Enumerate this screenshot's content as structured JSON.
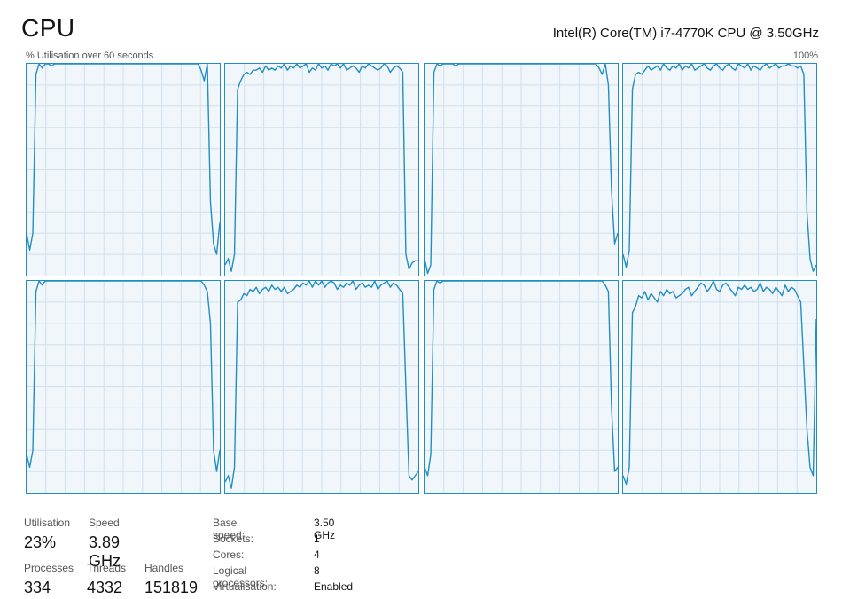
{
  "header": {
    "title": "CPU",
    "cpu_model": "Intel(R) Core(TM) i7-4770K CPU @ 3.50GHz",
    "axis_label": "% Utilisation over 60 seconds",
    "axis_max": "100%"
  },
  "colors": {
    "line": "#1f8ec4",
    "grid": "#cfe0ec",
    "panel_bg": "#f1f6fa",
    "border": "#1f8ec4"
  },
  "chart_data": [
    {
      "type": "line",
      "name": "logical-processor-0",
      "ylim": [
        0,
        100
      ],
      "values": [
        20,
        12,
        20,
        95,
        100,
        98,
        100,
        100,
        99,
        100,
        100,
        100,
        100,
        100,
        100,
        100,
        100,
        100,
        100,
        100,
        100,
        100,
        100,
        100,
        100,
        100,
        100,
        100,
        100,
        100,
        100,
        100,
        100,
        100,
        100,
        100,
        100,
        100,
        100,
        100,
        100,
        100,
        100,
        100,
        100,
        100,
        100,
        100,
        100,
        100,
        100,
        100,
        100,
        100,
        100,
        100,
        97,
        92,
        100,
        35,
        15,
        10,
        25
      ]
    },
    {
      "type": "line",
      "name": "logical-processor-1",
      "ylim": [
        0,
        100
      ],
      "values": [
        5,
        8,
        2,
        10,
        88,
        92,
        95,
        96,
        95,
        97,
        97,
        98,
        96,
        99,
        97,
        98,
        97,
        99,
        98,
        100,
        97,
        99,
        98,
        100,
        98,
        99,
        100,
        96,
        98,
        97,
        100,
        98,
        99,
        97,
        100,
        99,
        100,
        98,
        100,
        97,
        98,
        99,
        98,
        96,
        99,
        98,
        100,
        99,
        98,
        97,
        98,
        100,
        99,
        96,
        98,
        99,
        98,
        96,
        10,
        3,
        6,
        7,
        7
      ]
    },
    {
      "type": "line",
      "name": "logical-processor-2",
      "ylim": [
        0,
        100
      ],
      "values": [
        8,
        1,
        5,
        96,
        100,
        99,
        100,
        100,
        100,
        100,
        99,
        100,
        100,
        100,
        100,
        100,
        100,
        100,
        100,
        100,
        100,
        100,
        100,
        100,
        100,
        100,
        100,
        100,
        100,
        100,
        100,
        100,
        100,
        100,
        100,
        100,
        100,
        100,
        100,
        100,
        100,
        100,
        100,
        100,
        100,
        100,
        100,
        100,
        100,
        100,
        100,
        100,
        100,
        100,
        100,
        100,
        98,
        95,
        100,
        90,
        40,
        15,
        20
      ]
    },
    {
      "type": "line",
      "name": "logical-processor-3",
      "ylim": [
        0,
        100
      ],
      "values": [
        10,
        4,
        12,
        88,
        95,
        96,
        95,
        97,
        99,
        97,
        98,
        99,
        97,
        100,
        98,
        97,
        99,
        98,
        100,
        97,
        99,
        98,
        100,
        97,
        98,
        99,
        100,
        98,
        97,
        99,
        100,
        98,
        97,
        99,
        100,
        98,
        97,
        100,
        99,
        98,
        100,
        97,
        99,
        98,
        97,
        99,
        100,
        98,
        99,
        100,
        98,
        99,
        99,
        100,
        99,
        99,
        98,
        99,
        95,
        30,
        8,
        2,
        5
      ]
    },
    {
      "type": "line",
      "name": "logical-processor-4",
      "ylim": [
        0,
        100
      ],
      "values": [
        18,
        12,
        20,
        95,
        100,
        98,
        100,
        100,
        100,
        100,
        100,
        100,
        100,
        100,
        100,
        100,
        100,
        100,
        100,
        100,
        100,
        100,
        100,
        100,
        100,
        100,
        100,
        100,
        100,
        100,
        100,
        100,
        100,
        100,
        100,
        100,
        100,
        100,
        100,
        100,
        100,
        100,
        100,
        100,
        100,
        100,
        100,
        100,
        100,
        100,
        100,
        100,
        100,
        100,
        100,
        100,
        100,
        98,
        95,
        80,
        20,
        10,
        20
      ]
    },
    {
      "type": "line",
      "name": "logical-processor-5",
      "ylim": [
        0,
        100
      ],
      "values": [
        5,
        8,
        2,
        12,
        90,
        91,
        94,
        93,
        96,
        95,
        97,
        94,
        96,
        97,
        95,
        98,
        96,
        97,
        95,
        97,
        94,
        95,
        96,
        98,
        97,
        99,
        98,
        100,
        97,
        100,
        98,
        100,
        97,
        99,
        100,
        99,
        96,
        98,
        97,
        99,
        98,
        100,
        96,
        98,
        99,
        97,
        98,
        97,
        100,
        96,
        98,
        99,
        100,
        97,
        99,
        98,
        96,
        94,
        50,
        8,
        6,
        8,
        10
      ]
    },
    {
      "type": "line",
      "name": "logical-processor-6",
      "ylim": [
        0,
        100
      ],
      "values": [
        12,
        8,
        18,
        96,
        100,
        99,
        100,
        100,
        100,
        100,
        100,
        100,
        100,
        100,
        100,
        100,
        100,
        100,
        100,
        100,
        100,
        100,
        100,
        100,
        100,
        100,
        100,
        100,
        100,
        100,
        100,
        100,
        100,
        100,
        100,
        100,
        100,
        100,
        100,
        100,
        100,
        100,
        100,
        100,
        100,
        100,
        100,
        100,
        100,
        100,
        100,
        100,
        100,
        100,
        100,
        100,
        100,
        100,
        98,
        95,
        40,
        10,
        12
      ]
    },
    {
      "type": "line",
      "name": "logical-processor-7",
      "ylim": [
        0,
        100
      ],
      "values": [
        8,
        4,
        12,
        85,
        88,
        93,
        92,
        95,
        91,
        94,
        92,
        90,
        95,
        93,
        96,
        94,
        95,
        92,
        93,
        94,
        96,
        97,
        93,
        95,
        97,
        99,
        98,
        95,
        97,
        100,
        96,
        95,
        98,
        99,
        97,
        95,
        93,
        97,
        96,
        98,
        96,
        97,
        95,
        96,
        99,
        95,
        97,
        96,
        94,
        97,
        95,
        93,
        98,
        95,
        97,
        96,
        93,
        90,
        60,
        30,
        12,
        8,
        82
      ]
    }
  ],
  "stats": {
    "utilisation_label": "Utilisation",
    "utilisation_value": "23%",
    "speed_label": "Speed",
    "speed_value": "3.89 GHz",
    "processes_label": "Processes",
    "processes_value": "334",
    "threads_label": "Threads",
    "threads_value": "4332",
    "handles_label": "Handles",
    "handles_value": "151819"
  },
  "info": [
    {
      "label": "Base speed:",
      "value": "3.50 GHz"
    },
    {
      "label": "Sockets:",
      "value": "1"
    },
    {
      "label": "Cores:",
      "value": "4"
    },
    {
      "label": "Logical processors:",
      "value": "8"
    },
    {
      "label": "Virtualisation:",
      "value": "Enabled"
    }
  ]
}
